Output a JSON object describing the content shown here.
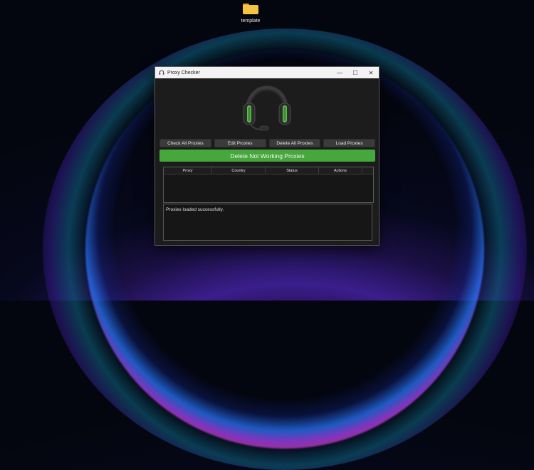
{
  "desktop": {
    "folder_label": "template"
  },
  "window": {
    "title": "Proxy Checker",
    "controls": {
      "minimize": "—",
      "maximize": "☐",
      "close": "✕"
    }
  },
  "toolbar": {
    "check_all": "Check All Proxies",
    "edit": "Edit Proxies",
    "delete_all": "Delete All Proxies",
    "load": "Load Proxies"
  },
  "primary_action": "Delete Not Working Proxies",
  "table": {
    "columns": [
      "Proxy",
      "Country",
      "Status",
      "Actions"
    ]
  },
  "log_text": "Proxies loaded successfully.",
  "colors": {
    "accent_green": "#46a73c",
    "window_bg": "#1c1c1c",
    "button_bg": "#3b3b3b"
  },
  "icons": {
    "app": "headset-icon",
    "folder": "folder-icon"
  }
}
